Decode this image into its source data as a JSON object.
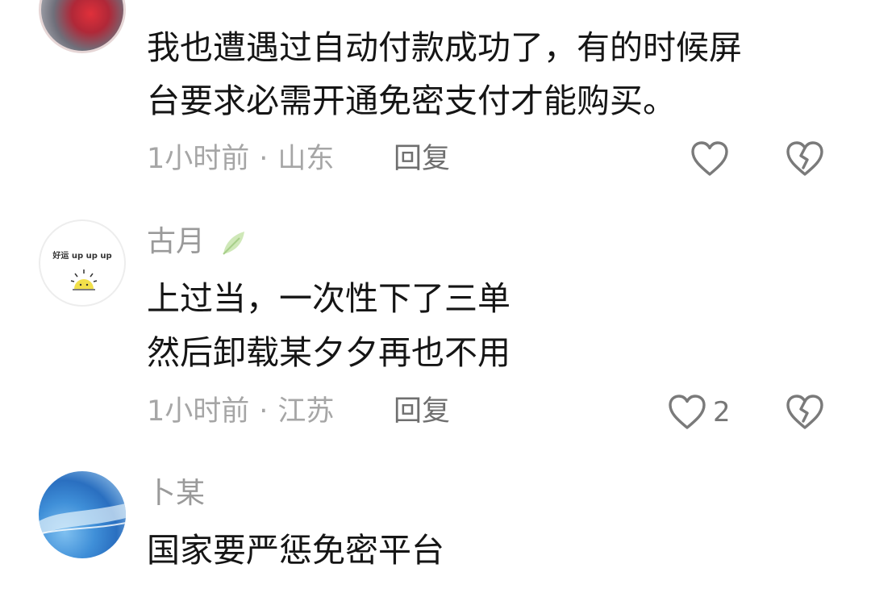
{
  "comments": [
    {
      "username": "",
      "text_lines": [
        "我也遭遇过自动付款成功了，有的时候屏",
        "台要求必需开通免密支付才能购买。"
      ],
      "time": "1小时前",
      "separator": "·",
      "location": "山东",
      "reply_label": "回复",
      "like_count": ""
    },
    {
      "username": "古月",
      "avatar_text": "好运 up up up",
      "text_lines": [
        "上过当，一次性下了三单",
        "然后卸载某夕夕再也不用"
      ],
      "time": "1小时前",
      "separator": "·",
      "location": "江苏",
      "reply_label": "回复",
      "like_count": "2"
    },
    {
      "username": "卜某",
      "text_lines": [
        "国家要严惩免密平台"
      ]
    }
  ],
  "icons": {
    "like": "heart-outline-icon",
    "dislike": "broken-heart-icon"
  },
  "colors": {
    "text": "#151515",
    "meta": "#a6a6a6",
    "icon": "#7a7a7a"
  }
}
